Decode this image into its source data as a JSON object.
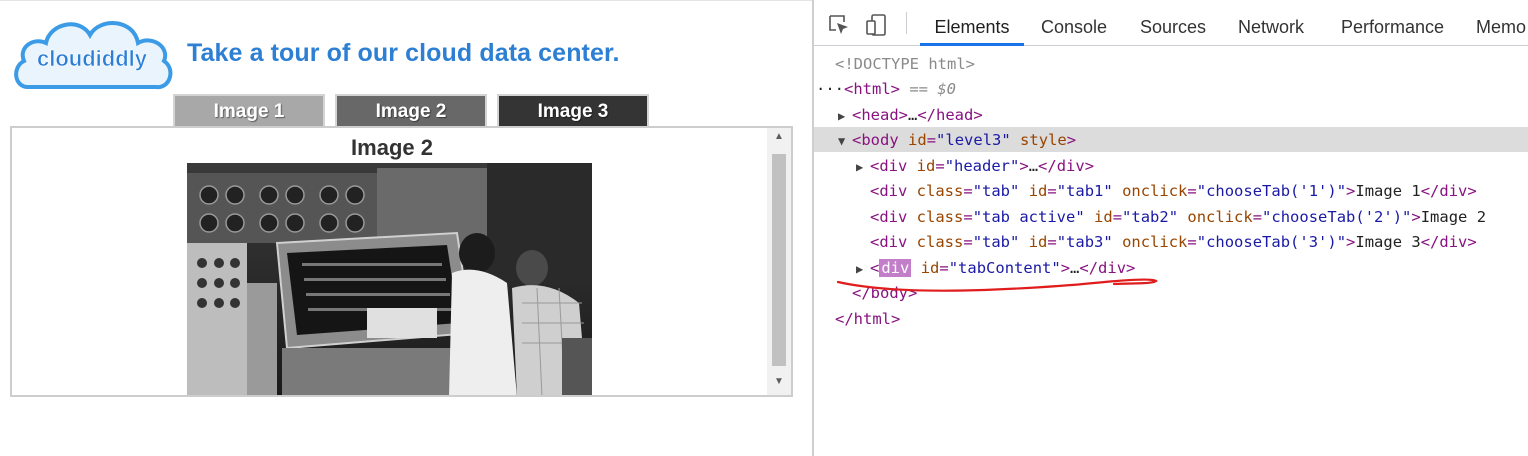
{
  "page": {
    "logo_text": "cloudiddly",
    "headline": "Take a tour of our cloud data center.",
    "tabs": [
      {
        "label": "Image 1"
      },
      {
        "label": "Image 2"
      },
      {
        "label": "Image 3"
      }
    ],
    "content_title": "Image 2"
  },
  "devtools": {
    "tabs": [
      {
        "label": "Elements",
        "active": true
      },
      {
        "label": "Console"
      },
      {
        "label": "Sources"
      },
      {
        "label": "Network"
      },
      {
        "label": "Performance"
      },
      {
        "label": "Memo"
      }
    ],
    "dom": {
      "doctype": "<!DOCTYPE html>",
      "html_open": "<html>",
      "selected_marker": "== $0",
      "dots": "···",
      "head_tag_open": "<head>",
      "ellipsis": "…",
      "head_tag_close": "</head>",
      "body_tag": "<body",
      "body_id_attr": "id",
      "body_id_val": "\"level3\"",
      "body_style_attr": "style",
      "gt": ">",
      "div_header_tag": "<div",
      "div_header_attr": "id",
      "div_header_val": "\"header\"",
      "div_close": "</div>",
      "tab1_text": "Image 1",
      "tab2_text": "Image 2",
      "tab3_text": "Image 3",
      "tabContent_tag": "div",
      "tabContent_attr": "id",
      "tabContent_val": "\"tabContent\"",
      "body_close": "</body>",
      "html_close": "</html>",
      "class_attr": "class",
      "id_attr": "id",
      "onclick_attr": "onclick",
      "tab_class": "\"tab\"",
      "tab_active_class": "\"tab active\"",
      "tab1_id": "\"tab1\"",
      "tab2_id": "\"tab2\"",
      "tab3_id": "\"tab3\"",
      "tab1_onclick": "\"chooseTab('1')\"",
      "tab2_onclick": "\"chooseTab('2')\"",
      "tab3_onclick": "\"chooseTab('3')\"",
      "div_open": "<div"
    }
  },
  "colors": {
    "headline": "#2d7fd3",
    "tab1": "#a8a8a8",
    "tab2": "#686868",
    "tab3": "#343434",
    "annotation": "#e01c1c",
    "devtools_accent": "#1a73e8"
  }
}
